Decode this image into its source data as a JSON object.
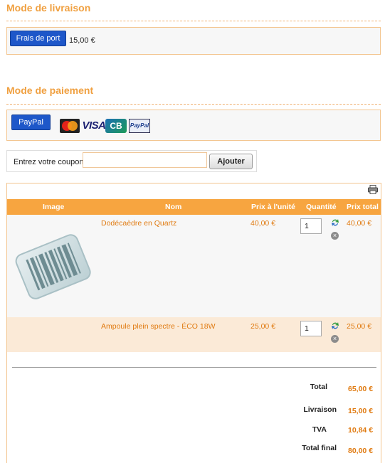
{
  "delivery": {
    "title": "Mode de livraison",
    "button_label": "Frais de port",
    "price": "15,00 €"
  },
  "payment": {
    "title": "Mode de paiement",
    "button_label": "PayPal",
    "cards": [
      "mastercard-icon",
      "visa-icon",
      "cb-icon",
      "paypal-icon"
    ],
    "card_texts": {
      "mastercard": "MasterCard",
      "visa": "VISA",
      "cb": "CB",
      "paypal": "PayPal"
    }
  },
  "coupon": {
    "label": "Entrez votre coupon",
    "value": "",
    "button_label": "Ajouter"
  },
  "cart": {
    "headers": [
      "Image",
      "Nom",
      "Prix à l'unité",
      "Quantité",
      "Prix total"
    ],
    "items": [
      {
        "name": "Dodécaèdre en Quartz",
        "unit_price": "40,00 €",
        "quantity": "1",
        "total": "40,00 €"
      },
      {
        "name": "Ampoule plein spectre - ÉCO 18W",
        "unit_price": "25,00 €",
        "quantity": "1",
        "total": "25,00 €"
      }
    ],
    "totals": [
      {
        "label": "Total",
        "value": "65,00 €"
      },
      {
        "label": "Livraison",
        "value": "15,00 €"
      },
      {
        "label": "TVA",
        "value": "10,84 €"
      },
      {
        "label": "Total final",
        "value": "80,00 €"
      }
    ]
  },
  "colors": {
    "accent": "#f7a540",
    "title": "#f0a040",
    "price": "#e07a10",
    "button": "#1e57c9"
  }
}
